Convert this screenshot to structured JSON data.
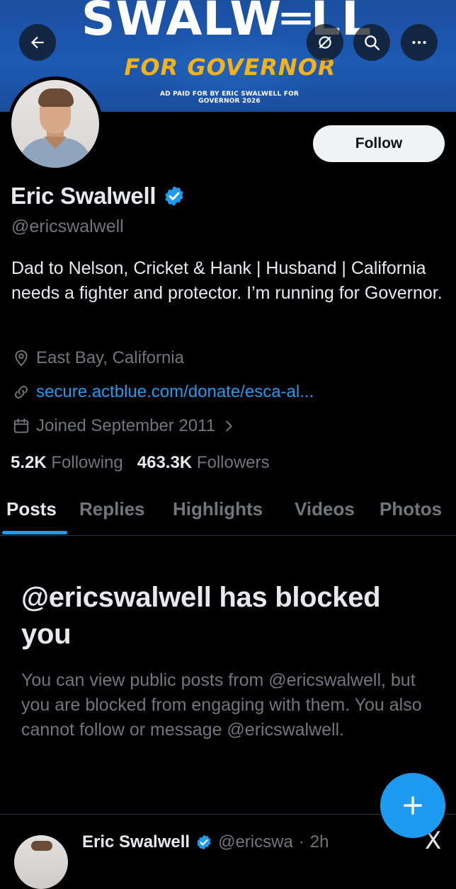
{
  "banner": {
    "title": "SWALW═LL",
    "subtitle": "FOR GOVERNOR",
    "disclaimer": "AD PAID FOR BY ERIC SWALWELL FOR GOVERNOR 2026",
    "colors": {
      "background": "#1d5ab3",
      "subtitle": "#f2b21c"
    }
  },
  "header": {
    "back_icon": "arrow-left-icon",
    "translate_icon": "translate-icon",
    "search_icon": "search-icon",
    "more_icon": "more-horizontal-icon"
  },
  "profile": {
    "follow_label": "Follow",
    "display_name": "Eric Swalwell",
    "verified": true,
    "handle": "@ericswalwell",
    "bio": "Dad to Nelson, Cricket & Hank | Husband | California needs a fighter and protector. I’m running for Governor.",
    "location": "East Bay, California",
    "link": "secure.actblue.com/donate/esca-al...",
    "joined": "Joined September 2011",
    "following_count": "5.2K",
    "following_label": "Following",
    "followers_count": "463.3K",
    "followers_label": "Followers"
  },
  "tabs": [
    {
      "label": "Posts",
      "active": true
    },
    {
      "label": "Replies",
      "active": false
    },
    {
      "label": "Highlights",
      "active": false
    },
    {
      "label": "Videos",
      "active": false
    },
    {
      "label": "Photos",
      "active": false
    }
  ],
  "blocked": {
    "title": "@ericswalwell has blocked you",
    "body": "You can view public posts from @ericswalwell, but you are blocked from engaging with them. You also cannot follow or message @ericswalwell."
  },
  "peek_post": {
    "name": "Eric Swalwell",
    "handle": "@ericswa",
    "separator": "·",
    "time": "2h",
    "close_glyph": "X"
  },
  "fab": {
    "icon": "plus-icon"
  },
  "colors": {
    "accent": "#1d9bf0",
    "text_primary": "#e7e9ea",
    "text_secondary": "#71767b",
    "background": "#000000"
  }
}
